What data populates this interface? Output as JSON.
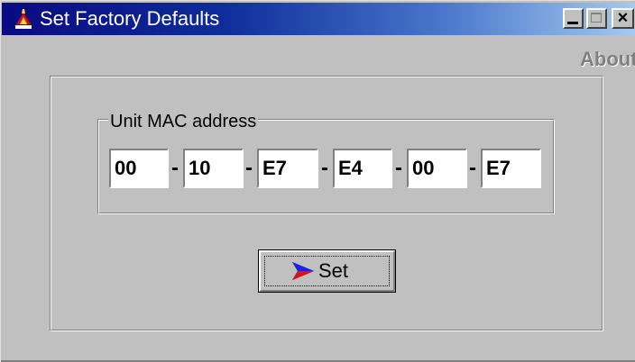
{
  "window": {
    "title": "Set Factory Defaults",
    "close_glyph": "×",
    "colors": {
      "face": "#c0c0c0",
      "titlebar_start": "#0a0a82",
      "titlebar_end": "#a6caf0"
    }
  },
  "menu": {
    "about_label": "About"
  },
  "mac_group": {
    "label": "Unit MAC address",
    "separator": "-",
    "octets": [
      "00",
      "10",
      "E7",
      "E4",
      "00",
      "E7"
    ]
  },
  "actions": {
    "set_label": "Set"
  },
  "icons": {
    "app": "app-icon",
    "set": "arrow-right-icon",
    "minimize": "minimize-icon",
    "maximize": "maximize-icon",
    "close": "close-icon"
  }
}
